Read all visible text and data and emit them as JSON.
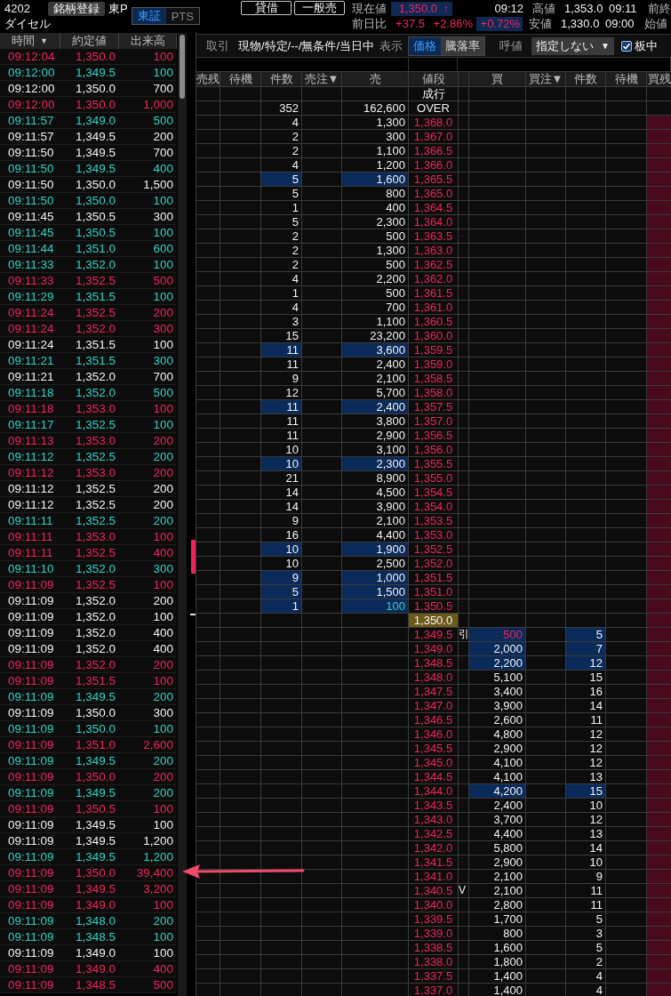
{
  "header": {
    "code": "4202",
    "register_button": "銘柄登録",
    "market": "東P",
    "market_tabs": [
      {
        "label": "東証",
        "selected": true
      },
      {
        "label": "PTS",
        "selected": false
      }
    ],
    "name": "ダイセル",
    "buttons": [
      "貸借",
      "一般売"
    ],
    "current": {
      "label": "現在値",
      "value": "1,350.0",
      "arrow": "↑"
    },
    "time": "09:12",
    "high": {
      "label": "高値",
      "value": "1,353.0",
      "time": "09:11"
    },
    "prev_close_label": "前終",
    "change": {
      "label": "前日比",
      "value": "+37.5",
      "percent": "+2.86%",
      "extra": "+0.72%"
    },
    "low": {
      "label": "安値",
      "value": "1,330.0",
      "time": "09:00"
    },
    "open_label": "始値"
  },
  "ticks": {
    "columns": [
      {
        "label": "時間",
        "sort_icon": "▼"
      },
      {
        "label": "約定値"
      },
      {
        "label": "出来高"
      }
    ],
    "rows": [
      {
        "time": "09:12:04",
        "price": "1,350.0",
        "volume": "100",
        "color": "#f0245a"
      },
      {
        "time": "09:12:00",
        "price": "1,349.5",
        "volume": "100",
        "color": "#2ad3c6"
      },
      {
        "time": "09:12:00",
        "price": "1,350.0",
        "volume": "700",
        "color": "#f2f2f2"
      },
      {
        "time": "09:12:00",
        "price": "1,350.0",
        "volume": "1,000",
        "color": "#f0245a"
      },
      {
        "time": "09:11:57",
        "price": "1,349.0",
        "volume": "500",
        "color": "#2ad3c6"
      },
      {
        "time": "09:11:57",
        "price": "1,349.5",
        "volume": "200",
        "color": "#f2f2f2"
      },
      {
        "time": "09:11:50",
        "price": "1,349.5",
        "volume": "700",
        "color": "#f2f2f2"
      },
      {
        "time": "09:11:50",
        "price": "1,349.5",
        "volume": "400",
        "color": "#2ad3c6"
      },
      {
        "time": "09:11:50",
        "price": "1,350.0",
        "volume": "1,500",
        "color": "#f2f2f2"
      },
      {
        "time": "09:11:50",
        "price": "1,350.0",
        "volume": "100",
        "color": "#2ad3c6"
      },
      {
        "time": "09:11:45",
        "price": "1,350.5",
        "volume": "300",
        "color": "#f2f2f2"
      },
      {
        "time": "09:11:45",
        "price": "1,350.5",
        "volume": "100",
        "color": "#2ad3c6"
      },
      {
        "time": "09:11:44",
        "price": "1,351.0",
        "volume": "600",
        "color": "#2ad3c6"
      },
      {
        "time": "09:11:33",
        "price": "1,352.0",
        "volume": "100",
        "color": "#2ad3c6"
      },
      {
        "time": "09:11:33",
        "price": "1,352.5",
        "volume": "500",
        "color": "#f0245a"
      },
      {
        "time": "09:11:29",
        "price": "1,351.5",
        "volume": "100",
        "color": "#2ad3c6"
      },
      {
        "time": "09:11:24",
        "price": "1,352.5",
        "volume": "200",
        "color": "#f0245a"
      },
      {
        "time": "09:11:24",
        "price": "1,352.0",
        "volume": "300",
        "color": "#f0245a"
      },
      {
        "time": "09:11:24",
        "price": "1,351.5",
        "volume": "100",
        "color": "#f2f2f2"
      },
      {
        "time": "09:11:21",
        "price": "1,351.5",
        "volume": "300",
        "color": "#2ad3c6"
      },
      {
        "time": "09:11:21",
        "price": "1,352.0",
        "volume": "700",
        "color": "#f2f2f2"
      },
      {
        "time": "09:11:18",
        "price": "1,352.0",
        "volume": "500",
        "color": "#2ad3c6"
      },
      {
        "time": "09:11:18",
        "price": "1,353.0",
        "volume": "100",
        "color": "#f0245a"
      },
      {
        "time": "09:11:17",
        "price": "1,352.5",
        "volume": "100",
        "color": "#2ad3c6"
      },
      {
        "time": "09:11:13",
        "price": "1,353.0",
        "volume": "200",
        "color": "#f0245a"
      },
      {
        "time": "09:11:12",
        "price": "1,352.5",
        "volume": "200",
        "color": "#2ad3c6"
      },
      {
        "time": "09:11:12",
        "price": "1,353.0",
        "volume": "200",
        "color": "#f0245a"
      },
      {
        "time": "09:11:12",
        "price": "1,352.5",
        "volume": "200",
        "color": "#f2f2f2"
      },
      {
        "time": "09:11:12",
        "price": "1,352.5",
        "volume": "200",
        "color": "#f2f2f2"
      },
      {
        "time": "09:11:11",
        "price": "1,352.5",
        "volume": "200",
        "color": "#2ad3c6"
      },
      {
        "time": "09:11:11",
        "price": "1,353.0",
        "volume": "100",
        "color": "#f0245a"
      },
      {
        "time": "09:11:11",
        "price": "1,352.5",
        "volume": "400",
        "color": "#f0245a"
      },
      {
        "time": "09:11:10",
        "price": "1,352.0",
        "volume": "300",
        "color": "#2ad3c6"
      },
      {
        "time": "09:11:09",
        "price": "1,352.5",
        "volume": "100",
        "color": "#f0245a"
      },
      {
        "time": "09:11:09",
        "price": "1,352.0",
        "volume": "200",
        "color": "#f2f2f2"
      },
      {
        "time": "09:11:09",
        "price": "1,352.0",
        "volume": "100",
        "color": "#f2f2f2"
      },
      {
        "time": "09:11:09",
        "price": "1,352.0",
        "volume": "400",
        "color": "#f2f2f2"
      },
      {
        "time": "09:11:09",
        "price": "1,352.0",
        "volume": "400",
        "color": "#f2f2f2"
      },
      {
        "time": "09:11:09",
        "price": "1,352.0",
        "volume": "200",
        "color": "#f0245a"
      },
      {
        "time": "09:11:09",
        "price": "1,351.5",
        "volume": "100",
        "color": "#f0245a"
      },
      {
        "time": "09:11:09",
        "price": "1,349.5",
        "volume": "200",
        "color": "#2ad3c6"
      },
      {
        "time": "09:11:09",
        "price": "1,350.0",
        "volume": "300",
        "color": "#f2f2f2"
      },
      {
        "time": "09:11:09",
        "price": "1,350.0",
        "volume": "100",
        "color": "#2ad3c6"
      },
      {
        "time": "09:11:09",
        "price": "1,351.0",
        "volume": "2,600",
        "color": "#f0245a"
      },
      {
        "time": "09:11:09",
        "price": "1,349.5",
        "volume": "200",
        "color": "#2ad3c6"
      },
      {
        "time": "09:11:09",
        "price": "1,350.0",
        "volume": "200",
        "color": "#f0245a"
      },
      {
        "time": "09:11:09",
        "price": "1,349.5",
        "volume": "200",
        "color": "#2ad3c6"
      },
      {
        "time": "09:11:09",
        "price": "1,350.5",
        "volume": "100",
        "color": "#f0245a"
      },
      {
        "time": "09:11:09",
        "price": "1,349.5",
        "volume": "100",
        "color": "#f2f2f2"
      },
      {
        "time": "09:11:09",
        "price": "1,349.5",
        "volume": "1,200",
        "color": "#f2f2f2"
      },
      {
        "time": "09:11:09",
        "price": "1,349.5",
        "volume": "1,200",
        "color": "#2ad3c6"
      },
      {
        "time": "09:11:09",
        "price": "1,350.0",
        "volume": "39,400",
        "color": "#f0245a"
      },
      {
        "time": "09:11:09",
        "price": "1,349.5",
        "volume": "3,200",
        "color": "#f0245a"
      },
      {
        "time": "09:11:09",
        "price": "1,349.0",
        "volume": "100",
        "color": "#f0245a"
      },
      {
        "time": "09:11:09",
        "price": "1,348.0",
        "volume": "200",
        "color": "#2ad3c6"
      },
      {
        "time": "09:11:09",
        "price": "1,348.5",
        "volume": "100",
        "color": "#2ad3c6"
      },
      {
        "time": "09:11:09",
        "price": "1,349.0",
        "volume": "100",
        "color": "#f2f2f2"
      },
      {
        "time": "09:11:09",
        "price": "1,349.0",
        "volume": "400",
        "color": "#f0245a"
      },
      {
        "time": "09:11:09",
        "price": "1,348.5",
        "volume": "500",
        "color": "#f0245a"
      }
    ]
  },
  "toolbar": {
    "trade_label": "取引",
    "trade_value": "現物/特定/--/無条件/当日中",
    "display_label": "表示",
    "display_tabs": [
      {
        "label": "価格",
        "selected": true
      },
      {
        "label": "騰落率",
        "selected": false
      }
    ],
    "tick_label": "呼値",
    "tick_select": "指定しない",
    "tick_select_caret": "▼",
    "center_checkbox": {
      "label": "板中",
      "checked": true
    }
  },
  "book": {
    "columns": [
      "売残",
      "待機",
      "件数",
      "売注▼",
      "売",
      "値段",
      "買",
      "買注▼",
      "件数",
      "待機",
      "買残"
    ],
    "rows_above_line": [
      {
        "kind": "label",
        "price": "成行",
        "highlighted": false
      },
      {
        "kind": "label",
        "price": "OVER",
        "sell_count": "352",
        "sell_qty": "162,600",
        "highlighted": false
      },
      {
        "kind": "ask",
        "price": "1,368.0",
        "sell_count": "4",
        "sell_qty": "1,300",
        "highlighted": false
      },
      {
        "kind": "ask",
        "price": "1,367.0",
        "sell_count": "2",
        "sell_qty": "300",
        "highlighted": false
      },
      {
        "kind": "ask",
        "price": "1,366.5",
        "sell_count": "2",
        "sell_qty": "1,100",
        "highlighted": false
      },
      {
        "kind": "ask",
        "price": "1,366.0",
        "sell_count": "4",
        "sell_qty": "1,200",
        "highlighted": false
      },
      {
        "kind": "ask",
        "price": "1,365.5",
        "sell_count": "5",
        "sell_qty": "1,600",
        "highlighted": true
      },
      {
        "kind": "ask",
        "price": "1,365.0",
        "sell_count": "5",
        "sell_qty": "800",
        "highlighted": false
      },
      {
        "kind": "ask",
        "price": "1,364.5",
        "sell_count": "1",
        "sell_qty": "400",
        "highlighted": false
      },
      {
        "kind": "ask",
        "price": "1,364.0",
        "sell_count": "5",
        "sell_qty": "2,300",
        "highlighted": false
      },
      {
        "kind": "ask",
        "price": "1,363.5",
        "sell_count": "2",
        "sell_qty": "500",
        "highlighted": false
      },
      {
        "kind": "ask",
        "price": "1,363.0",
        "sell_count": "2",
        "sell_qty": "1,300",
        "highlighted": false
      },
      {
        "kind": "ask",
        "price": "1,362.5",
        "sell_count": "2",
        "sell_qty": "500",
        "highlighted": false
      },
      {
        "kind": "ask",
        "price": "1,362.0",
        "sell_count": "4",
        "sell_qty": "2,200",
        "highlighted": false
      },
      {
        "kind": "ask",
        "price": "1,361.5",
        "sell_count": "1",
        "sell_qty": "500",
        "highlighted": false
      },
      {
        "kind": "ask",
        "price": "1,361.0",
        "sell_count": "4",
        "sell_qty": "700",
        "highlighted": false
      },
      {
        "kind": "ask",
        "price": "1,360.5",
        "sell_count": "3",
        "sell_qty": "1,100",
        "highlighted": false
      },
      {
        "kind": "ask",
        "price": "1,360.0",
        "sell_count": "15",
        "sell_qty": "23,200",
        "highlighted": false
      },
      {
        "kind": "ask",
        "price": "1,359.5",
        "sell_count": "11",
        "sell_qty": "3,600",
        "highlighted": true
      },
      {
        "kind": "ask",
        "price": "1,359.0",
        "sell_count": "11",
        "sell_qty": "2,400",
        "highlighted": false
      },
      {
        "kind": "ask",
        "price": "1,358.5",
        "sell_count": "9",
        "sell_qty": "2,100",
        "highlighted": false
      },
      {
        "kind": "ask",
        "price": "1,358.0",
        "sell_count": "12",
        "sell_qty": "5,700",
        "highlighted": false
      },
      {
        "kind": "ask",
        "price": "1,357.5",
        "sell_count": "11",
        "sell_qty": "2,400",
        "highlighted": true
      },
      {
        "kind": "ask",
        "price": "1,357.0",
        "sell_count": "11",
        "sell_qty": "3,800",
        "highlighted": false
      },
      {
        "kind": "ask",
        "price": "1,356.5",
        "sell_count": "11",
        "sell_qty": "2,900",
        "highlighted": false
      },
      {
        "kind": "ask",
        "price": "1,356.0",
        "sell_count": "10",
        "sell_qty": "3,100",
        "highlighted": false
      },
      {
        "kind": "ask",
        "price": "1,355.5",
        "sell_count": "10",
        "sell_qty": "2,300",
        "highlighted": true
      },
      {
        "kind": "ask",
        "price": "1,355.0",
        "sell_count": "21",
        "sell_qty": "8,900",
        "highlighted": false
      },
      {
        "kind": "ask",
        "price": "1,354.5",
        "sell_count": "14",
        "sell_qty": "4,500",
        "highlighted": false
      },
      {
        "kind": "ask",
        "price": "1,354.0",
        "sell_count": "14",
        "sell_qty": "3,900",
        "highlighted": false
      },
      {
        "kind": "ask",
        "price": "1,353.5",
        "sell_count": "9",
        "sell_qty": "2,100",
        "highlighted": false
      }
    ],
    "rows_below_line": [
      {
        "kind": "ask",
        "price": "1,353.0",
        "sell_count": "16",
        "sell_qty": "4,400",
        "highlighted": false
      },
      {
        "kind": "ask",
        "price": "1,352.5",
        "sell_count": "10",
        "sell_qty": "1,900",
        "highlighted": true
      },
      {
        "kind": "ask",
        "price": "1,352.0",
        "sell_count": "10",
        "sell_qty": "2,500",
        "highlighted": false
      },
      {
        "kind": "ask",
        "price": "1,351.5",
        "sell_count": "9",
        "sell_qty": "1,000",
        "highlighted": true
      },
      {
        "kind": "ask",
        "price": "1,351.0",
        "sell_count": "5",
        "sell_qty": "1,500",
        "highlighted": true
      },
      {
        "kind": "ask",
        "price": "1,350.5",
        "sell_count": "1",
        "sell_qty": "100",
        "color": "#2ad3c6",
        "highlighted": true
      },
      {
        "kind": "current",
        "price": "1,350.0",
        "highlighted": false
      },
      {
        "kind": "bid",
        "price": "1,349.5",
        "flag": "引",
        "buy_qty": "500",
        "color": "#f0245a",
        "buy_count": "5",
        "highlighted": true
      },
      {
        "kind": "bid",
        "price": "1,349.0",
        "buy_qty": "2,000",
        "buy_count": "7",
        "highlighted": true
      },
      {
        "kind": "bid",
        "price": "1,348.5",
        "buy_qty": "2,200",
        "buy_count": "12",
        "highlighted": true
      },
      {
        "kind": "bid",
        "price": "1,348.0",
        "buy_qty": "5,100",
        "buy_count": "15",
        "highlighted": false
      },
      {
        "kind": "bid",
        "price": "1,347.5",
        "buy_qty": "3,400",
        "buy_count": "16",
        "highlighted": false
      },
      {
        "kind": "bid",
        "price": "1,347.0",
        "buy_qty": "3,900",
        "buy_count": "14",
        "highlighted": false
      },
      {
        "kind": "bid",
        "price": "1,346.5",
        "buy_qty": "2,600",
        "buy_count": "11",
        "highlighted": false
      },
      {
        "kind": "bid",
        "price": "1,346.0",
        "buy_qty": "4,800",
        "buy_count": "12",
        "highlighted": false
      },
      {
        "kind": "bid",
        "price": "1,345.5",
        "buy_qty": "2,900",
        "buy_count": "12",
        "highlighted": false
      },
      {
        "kind": "bid",
        "price": "1,345.0",
        "buy_qty": "4,100",
        "buy_count": "12",
        "highlighted": false
      },
      {
        "kind": "bid",
        "price": "1,344.5",
        "buy_qty": "4,100",
        "buy_count": "13",
        "highlighted": false
      },
      {
        "kind": "bid",
        "price": "1,344.0",
        "buy_qty": "4,200",
        "buy_count": "15",
        "highlighted": true
      },
      {
        "kind": "bid",
        "price": "1,343.5",
        "buy_qty": "2,400",
        "buy_count": "10",
        "highlighted": false
      },
      {
        "kind": "bid",
        "price": "1,343.0",
        "buy_qty": "3,700",
        "buy_count": "12",
        "highlighted": false
      },
      {
        "kind": "bid",
        "price": "1,342.5",
        "buy_qty": "4,400",
        "buy_count": "13",
        "highlighted": false
      },
      {
        "kind": "bid",
        "price": "1,342.0",
        "buy_qty": "5,800",
        "buy_count": "14",
        "highlighted": false
      },
      {
        "kind": "bid",
        "price": "1,341.5",
        "buy_qty": "2,900",
        "buy_count": "10",
        "highlighted": false
      },
      {
        "kind": "bid",
        "price": "1,341.0",
        "buy_qty": "2,100",
        "buy_count": "9",
        "highlighted": false
      },
      {
        "kind": "bid",
        "price": "1,340.5",
        "flag": "V",
        "buy_qty": "2,100",
        "buy_count": "11",
        "highlighted": false
      },
      {
        "kind": "bid",
        "price": "1,340.0",
        "buy_qty": "2,800",
        "buy_count": "11",
        "highlighted": false
      },
      {
        "kind": "bid",
        "price": "1,339.5",
        "buy_qty": "1,700",
        "buy_count": "5",
        "highlighted": false
      },
      {
        "kind": "bid",
        "price": "1,339.0",
        "buy_qty": "800",
        "buy_count": "3",
        "highlighted": false
      },
      {
        "kind": "bid",
        "price": "1,338.5",
        "buy_qty": "1,600",
        "buy_count": "5",
        "highlighted": false
      },
      {
        "kind": "bid",
        "price": "1,338.0",
        "buy_qty": "1,800",
        "buy_count": "2",
        "highlighted": false
      },
      {
        "kind": "bid",
        "price": "1,337.5",
        "buy_qty": "1,400",
        "buy_count": "4",
        "highlighted": false
      },
      {
        "kind": "bid",
        "price": "1,337.0",
        "buy_qty": "1,400",
        "buy_count": "4",
        "highlighted": false
      }
    ]
  }
}
